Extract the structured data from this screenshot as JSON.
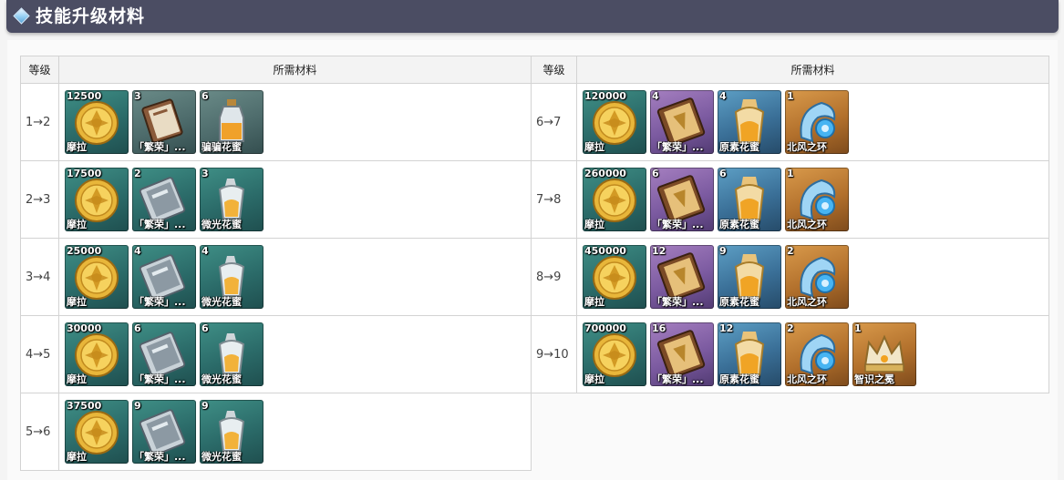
{
  "header": {
    "title": "技能升级材料"
  },
  "columns": {
    "level": "等级",
    "materials": "所需材料"
  },
  "rows": [
    {
      "left": {
        "level": "1→2",
        "items": [
          {
            "icon": "mora-coin-icon",
            "rarity": "r3",
            "count": "12500",
            "name": "摩拉"
          },
          {
            "icon": "teachings-book-icon",
            "rarity": "r2",
            "count": "3",
            "name": "「繁荣」..."
          },
          {
            "icon": "nectar-bottle-icon",
            "rarity": "r2",
            "count": "6",
            "name": "骗骗花蜜"
          }
        ]
      },
      "right": {
        "level": "6→7",
        "items": [
          {
            "icon": "mora-coin-icon",
            "rarity": "r3",
            "count": "120000",
            "name": "摩拉"
          },
          {
            "icon": "philosophies-book-icon",
            "rarity": "r4",
            "count": "4",
            "name": "「繁荣」..."
          },
          {
            "icon": "energy-nectar-icon",
            "rarity": "r3b",
            "count": "4",
            "name": "原素花蜜"
          },
          {
            "icon": "ring-of-boreas-icon",
            "rarity": "r5",
            "count": "1",
            "name": "北风之环"
          }
        ]
      }
    },
    {
      "left": {
        "level": "2→3",
        "items": [
          {
            "icon": "mora-coin-icon",
            "rarity": "r3",
            "count": "17500",
            "name": "摩拉"
          },
          {
            "icon": "guide-book-icon",
            "rarity": "r3",
            "count": "2",
            "name": "「繁荣」..."
          },
          {
            "icon": "shimmering-nectar-icon",
            "rarity": "r3",
            "count": "3",
            "name": "微光花蜜"
          }
        ]
      },
      "right": {
        "level": "7→8",
        "items": [
          {
            "icon": "mora-coin-icon",
            "rarity": "r3",
            "count": "260000",
            "name": "摩拉"
          },
          {
            "icon": "philosophies-book-icon",
            "rarity": "r4",
            "count": "6",
            "name": "「繁荣」..."
          },
          {
            "icon": "energy-nectar-icon",
            "rarity": "r3b",
            "count": "6",
            "name": "原素花蜜"
          },
          {
            "icon": "ring-of-boreas-icon",
            "rarity": "r5",
            "count": "1",
            "name": "北风之环"
          }
        ]
      }
    },
    {
      "left": {
        "level": "3→4",
        "items": [
          {
            "icon": "mora-coin-icon",
            "rarity": "r3",
            "count": "25000",
            "name": "摩拉"
          },
          {
            "icon": "guide-book-icon",
            "rarity": "r3",
            "count": "4",
            "name": "「繁荣」..."
          },
          {
            "icon": "shimmering-nectar-icon",
            "rarity": "r3",
            "count": "4",
            "name": "微光花蜜"
          }
        ]
      },
      "right": {
        "level": "8→9",
        "items": [
          {
            "icon": "mora-coin-icon",
            "rarity": "r3",
            "count": "450000",
            "name": "摩拉"
          },
          {
            "icon": "philosophies-book-icon",
            "rarity": "r4",
            "count": "12",
            "name": "「繁荣」..."
          },
          {
            "icon": "energy-nectar-icon",
            "rarity": "r3b",
            "count": "9",
            "name": "原素花蜜"
          },
          {
            "icon": "ring-of-boreas-icon",
            "rarity": "r5",
            "count": "2",
            "name": "北风之环"
          }
        ]
      }
    },
    {
      "left": {
        "level": "4→5",
        "items": [
          {
            "icon": "mora-coin-icon",
            "rarity": "r3",
            "count": "30000",
            "name": "摩拉"
          },
          {
            "icon": "guide-book-icon",
            "rarity": "r3",
            "count": "6",
            "name": "「繁荣」..."
          },
          {
            "icon": "shimmering-nectar-icon",
            "rarity": "r3",
            "count": "6",
            "name": "微光花蜜"
          }
        ]
      },
      "right": {
        "level": "9→10",
        "items": [
          {
            "icon": "mora-coin-icon",
            "rarity": "r3",
            "count": "700000",
            "name": "摩拉"
          },
          {
            "icon": "philosophies-book-icon",
            "rarity": "r4",
            "count": "16",
            "name": "「繁荣」..."
          },
          {
            "icon": "energy-nectar-icon",
            "rarity": "r3b",
            "count": "12",
            "name": "原素花蜜"
          },
          {
            "icon": "ring-of-boreas-icon",
            "rarity": "r5",
            "count": "2",
            "name": "北风之环"
          },
          {
            "icon": "crown-of-insight-icon",
            "rarity": "r5",
            "count": "1",
            "name": "智识之冕"
          }
        ]
      }
    },
    {
      "left": {
        "level": "5→6",
        "items": [
          {
            "icon": "mora-coin-icon",
            "rarity": "r3",
            "count": "37500",
            "name": "摩拉"
          },
          {
            "icon": "guide-book-icon",
            "rarity": "r3",
            "count": "9",
            "name": "「繁荣」..."
          },
          {
            "icon": "shimmering-nectar-icon",
            "rarity": "r3",
            "count": "9",
            "name": "微光花蜜"
          }
        ]
      },
      "right": null
    }
  ]
}
